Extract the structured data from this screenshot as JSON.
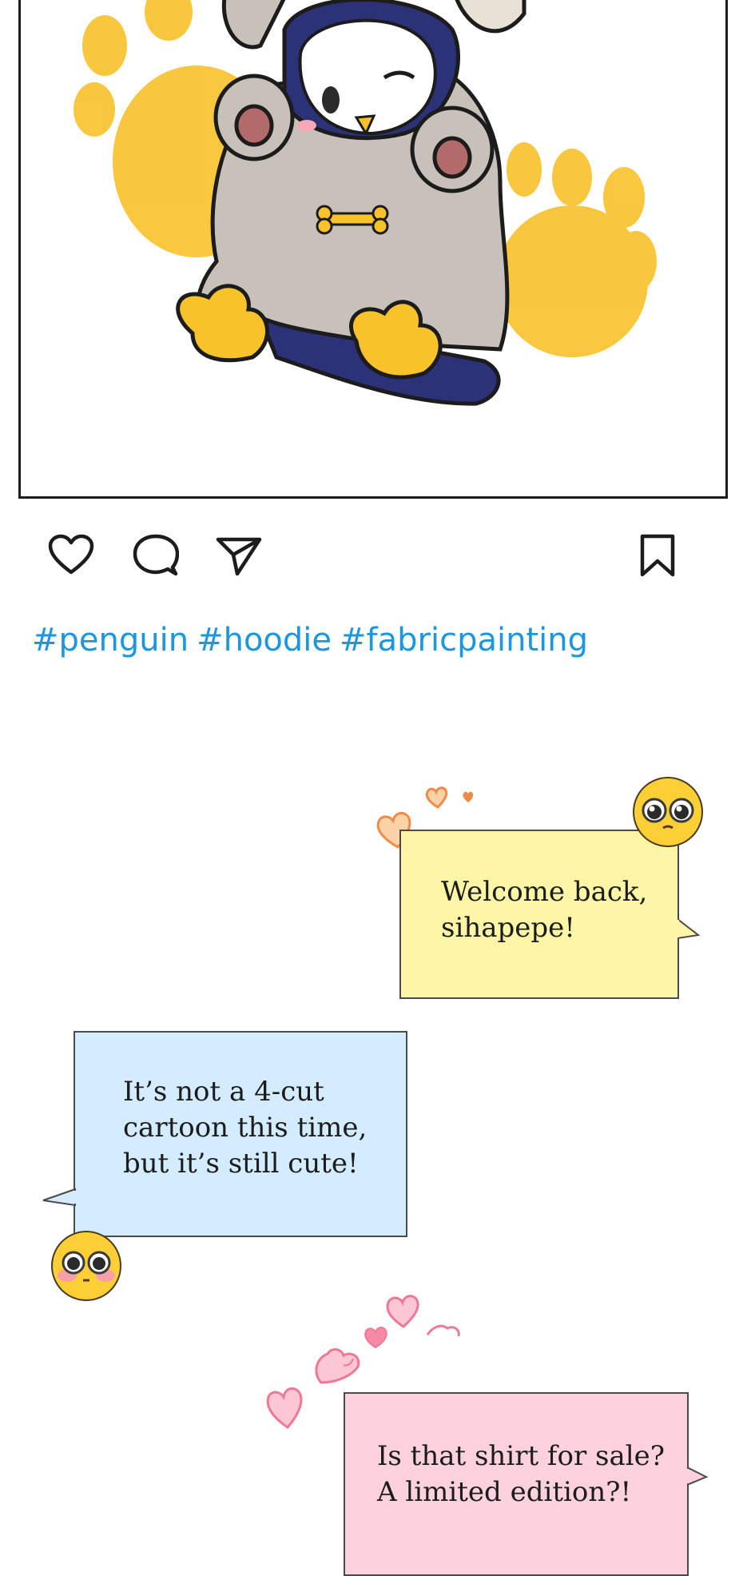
{
  "post": {
    "image_alt": "penguin-in-hoodie-illustration",
    "actions": {
      "like_icon": "heart-outline-icon",
      "comment_icon": "speech-bubble-outline-icon",
      "share_icon": "paper-plane-icon",
      "save_icon": "bookmark-outline-icon"
    },
    "hashtags": [
      "#penguin",
      "#hoodie",
      "#fabricpainting"
    ]
  },
  "comments": [
    {
      "line1": "Welcome back,",
      "line2": "sihapepe!",
      "bg": "#fdf6a6",
      "emoji": "pleading-face-icon"
    },
    {
      "line1": "It’s not a 4-cut",
      "line2": "cartoon this time,",
      "line3": "but it’s still cute!",
      "bg": "#d3ecff",
      "emoji": "blushing-face-icon"
    },
    {
      "line1": "Is that shirt for sale?",
      "line2": "A limited edition?!",
      "bg": "#fdd2de",
      "emoji": "hearts-decoration-icon"
    }
  ],
  "colors": {
    "hashtag": "#1a97e0",
    "border": "#1c1c1c",
    "paw_yellow": "#f8c22a",
    "hoodie_gray": "#c7c1b9",
    "penguin_navy": "#2b3278"
  }
}
